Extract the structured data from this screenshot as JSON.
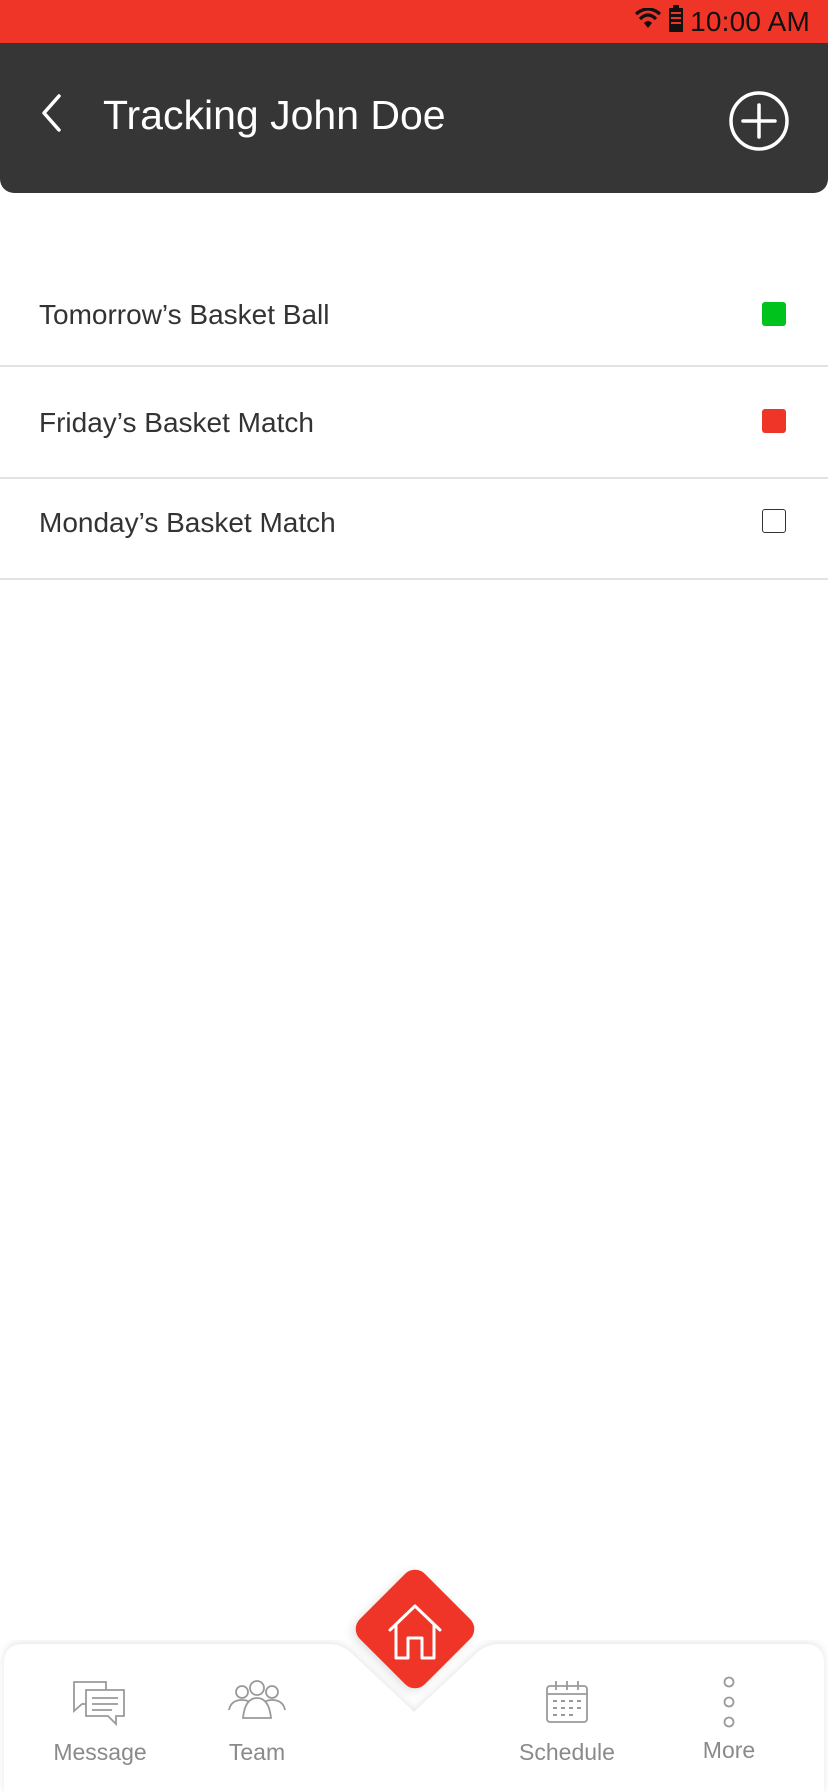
{
  "status_bar": {
    "time": "10:00 AM",
    "icons": [
      "wifi-icon",
      "battery-icon"
    ],
    "color": "#ee3528"
  },
  "header": {
    "title": "Tracking John Doe",
    "back_icon": "chevron-left-icon",
    "add_icon": "plus-circle-icon",
    "background": "#363636"
  },
  "events": [
    {
      "label": "Tomorrow’s Basket Ball",
      "status": "green",
      "color": "#00c21d"
    },
    {
      "label": "Friday’s Basket Match",
      "status": "red",
      "color": "#ee3528"
    },
    {
      "label": "Monday’s Basket Match",
      "status": "empty",
      "color": "#ffffff"
    }
  ],
  "bottom_nav": {
    "items": [
      {
        "label": "Message",
        "icon": "message-icon"
      },
      {
        "label": "Team",
        "icon": "team-icon"
      },
      {
        "label": "Schedule",
        "icon": "calendar-icon"
      },
      {
        "label": "More",
        "icon": "more-vertical-icon"
      }
    ],
    "home_icon": "home-icon",
    "home_color": "#ee3528"
  }
}
